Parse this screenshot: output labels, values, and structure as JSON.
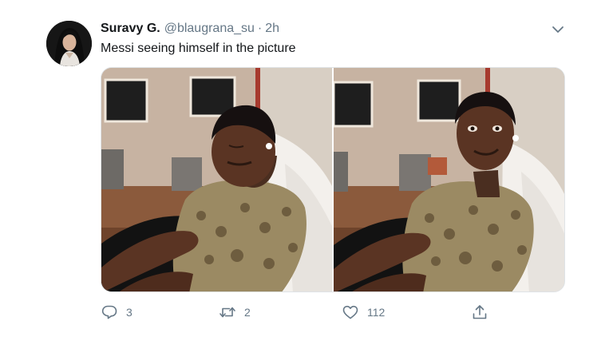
{
  "user": {
    "display_name": "Suravy G.",
    "handle": "@blaugrana_su",
    "separator": "·",
    "time": "2h"
  },
  "tweet": {
    "text": "Messi seeing himself in the picture"
  },
  "media": {
    "left_image": "girl-looking-down-photo",
    "right_image": "girl-smiling-at-camera-photo"
  },
  "actions": {
    "reply_count": "3",
    "retweet_count": "2",
    "like_count": "112"
  },
  "icons": {
    "reply": "comment-icon",
    "retweet": "retweet-icon",
    "like": "heart-icon",
    "share": "share-icon",
    "menu": "chevron-down-icon"
  },
  "colors": {
    "text": "#14171a",
    "secondary": "#657786"
  }
}
